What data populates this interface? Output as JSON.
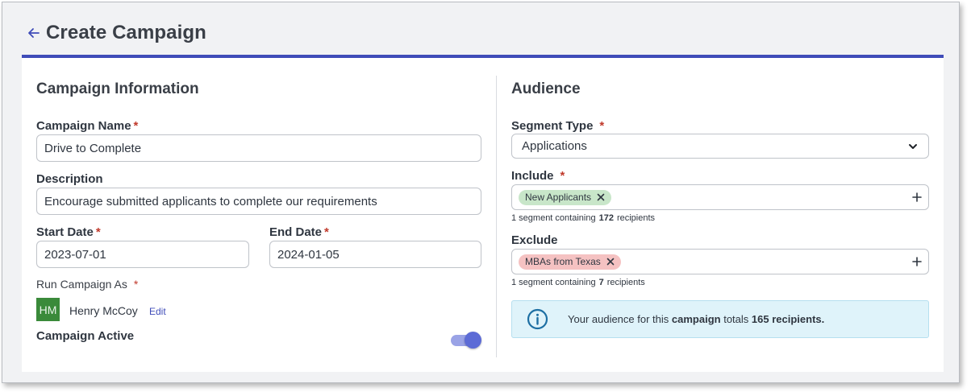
{
  "header": {
    "title": "Create Campaign"
  },
  "info": {
    "section_title": "Campaign Information",
    "name_label": "Campaign Name",
    "name_value": "Drive to Complete",
    "description_label": "Description",
    "description_value": "Encourage submitted applicants to complete our requirements",
    "start_label": "Start Date",
    "start_value": "2023-07-01",
    "end_label": "End Date",
    "end_value": "2024-01-05",
    "run_as_label": "Run Campaign As",
    "user_initials": "HM",
    "user_name": "Henry McCoy",
    "edit_label": "Edit",
    "active_label": "Campaign Active",
    "active": true,
    "required_mark": "*"
  },
  "audience": {
    "section_title": "Audience",
    "segment_type_label": "Segment Type",
    "segment_type_value": "Applications",
    "include_label": "Include",
    "include_tag": "New Applicants",
    "include_hint_prefix": "1 segment containing",
    "include_count": "172",
    "include_hint_suffix": "recipients",
    "exclude_label": "Exclude",
    "exclude_tag": "MBAs from Texas",
    "exclude_hint_prefix": "1 segment containing",
    "exclude_count": "7",
    "exclude_hint_suffix": "recipients",
    "alert_prefix": "Your audience for this",
    "alert_bold1": "campaign",
    "alert_mid": "totals",
    "alert_bold2": "165 recipients."
  },
  "colors": {
    "accent": "#3f4cb8",
    "include_tag": "#c8e6c9",
    "exclude_tag": "#f5c2c2",
    "alert_bg": "#dff3fa",
    "avatar": "#3a8a3a",
    "required": "#c0392b"
  },
  "icons": {
    "back": "arrow-left-icon",
    "chevron": "chevron-down-icon",
    "remove": "close-icon",
    "add": "plus-icon",
    "info": "info-circle-icon"
  }
}
